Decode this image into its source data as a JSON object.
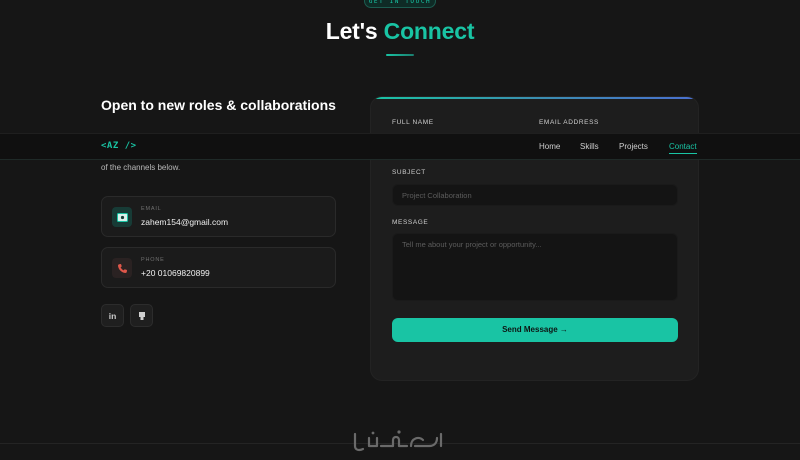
{
  "section": {
    "eyebrow": "GET IN TOUCH",
    "title_part1": "Let's ",
    "title_accent": "Connect"
  },
  "left": {
    "heading": "Open to new roles & collaborations",
    "intro_fragment": "of the channels below.",
    "email": {
      "label": "EMAIL",
      "value": "zahem154@gmail.com",
      "icon": "email-icon"
    },
    "phone": {
      "label": "PHONE",
      "value": "+20 01069820899",
      "icon": "phone-icon"
    },
    "socials": [
      {
        "icon": "linkedin-icon",
        "text": "in"
      },
      {
        "icon": "github-icon"
      }
    ]
  },
  "form": {
    "full_name_label": "FULL NAME",
    "email_label": "EMAIL ADDRESS",
    "subject_label": "SUBJECT",
    "subject_placeholder": "Project Collaboration",
    "message_label": "MESSAGE",
    "message_placeholder": "Tell me about your project or opportunity...",
    "send_label": "Send Message →"
  },
  "nav": {
    "logo_open": "<AZ ",
    "logo_close": "/>",
    "items": [
      "Home",
      "Skills",
      "Projects",
      "Contact"
    ],
    "active": "Contact"
  },
  "watermark": {
    "text": "خمسات"
  },
  "colors": {
    "accent": "#19c4a4",
    "background": "#161616",
    "card": "#1d1d1d"
  }
}
